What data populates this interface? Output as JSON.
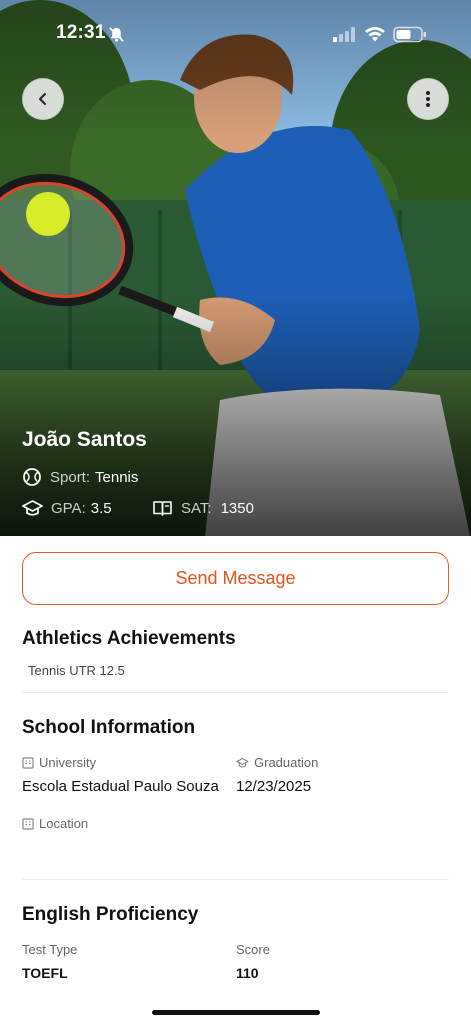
{
  "status_bar": {
    "time": "12:31"
  },
  "athlete": {
    "name": "João Santos",
    "sport_label": "Sport:",
    "sport": "Tennis",
    "gpa_label": "GPA:",
    "gpa": "3.5",
    "sat_label": "SAT:",
    "sat": "1350"
  },
  "actions": {
    "send_message": "Send Message"
  },
  "athletics": {
    "title": "Athletics Achievements",
    "items": [
      "Tennis UTR 12.5"
    ]
  },
  "school": {
    "title": "School Information",
    "university_label": "University",
    "university": "Escola Estadual Paulo Souza",
    "graduation_label": "Graduation",
    "graduation": "12/23/2025",
    "location_label": "Location",
    "location": ""
  },
  "english": {
    "title": "English Proficiency",
    "test_type_label": "Test Type",
    "test_type": "TOEFL",
    "score_label": "Score",
    "score": "110"
  },
  "colors": {
    "accent": "#e0531a",
    "text": "#111111",
    "muted": "#666666"
  },
  "icons": [
    "bell-slash-icon",
    "signal-icon",
    "wifi-icon",
    "battery-icon",
    "back-chevron-icon",
    "more-vertical-icon",
    "tennis-ball-icon",
    "graduation-cap-icon",
    "book-icon",
    "building-icon"
  ]
}
